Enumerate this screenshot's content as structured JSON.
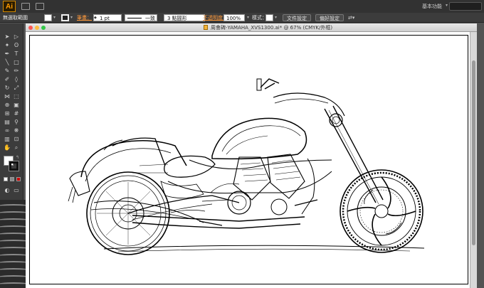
{
  "app": {
    "logo": "Ai",
    "workspace": "基本功能"
  },
  "control_bar": {
    "selection_label": "無選取範圍",
    "stroke_label": "筆畫：",
    "stroke_weight": "1 pt",
    "stroke_profile": "一致",
    "brush": "3 點圓形",
    "opacity_label": "不透明度：",
    "opacity": "100%",
    "style_label": "樣式：",
    "document_setup_button": "文件設定",
    "preferences_button": "偏好設定"
  },
  "document": {
    "title": "周會碑-YAMAHA_XVS1300.ai* @ 67% (CMYK/外框)"
  },
  "colors": {
    "accent_label": "#ff9a3c",
    "panel": "#3c3c3c",
    "app_bar": "#323232",
    "pasteboard": "#535353"
  },
  "icons": [
    "ai-logo-icon",
    "bridge-icon",
    "layout-icon",
    "selection-tool-icon",
    "direct-selection-tool-icon",
    "pen-tool-icon",
    "type-tool-icon",
    "hand-tool-icon",
    "zoom-tool-icon"
  ]
}
